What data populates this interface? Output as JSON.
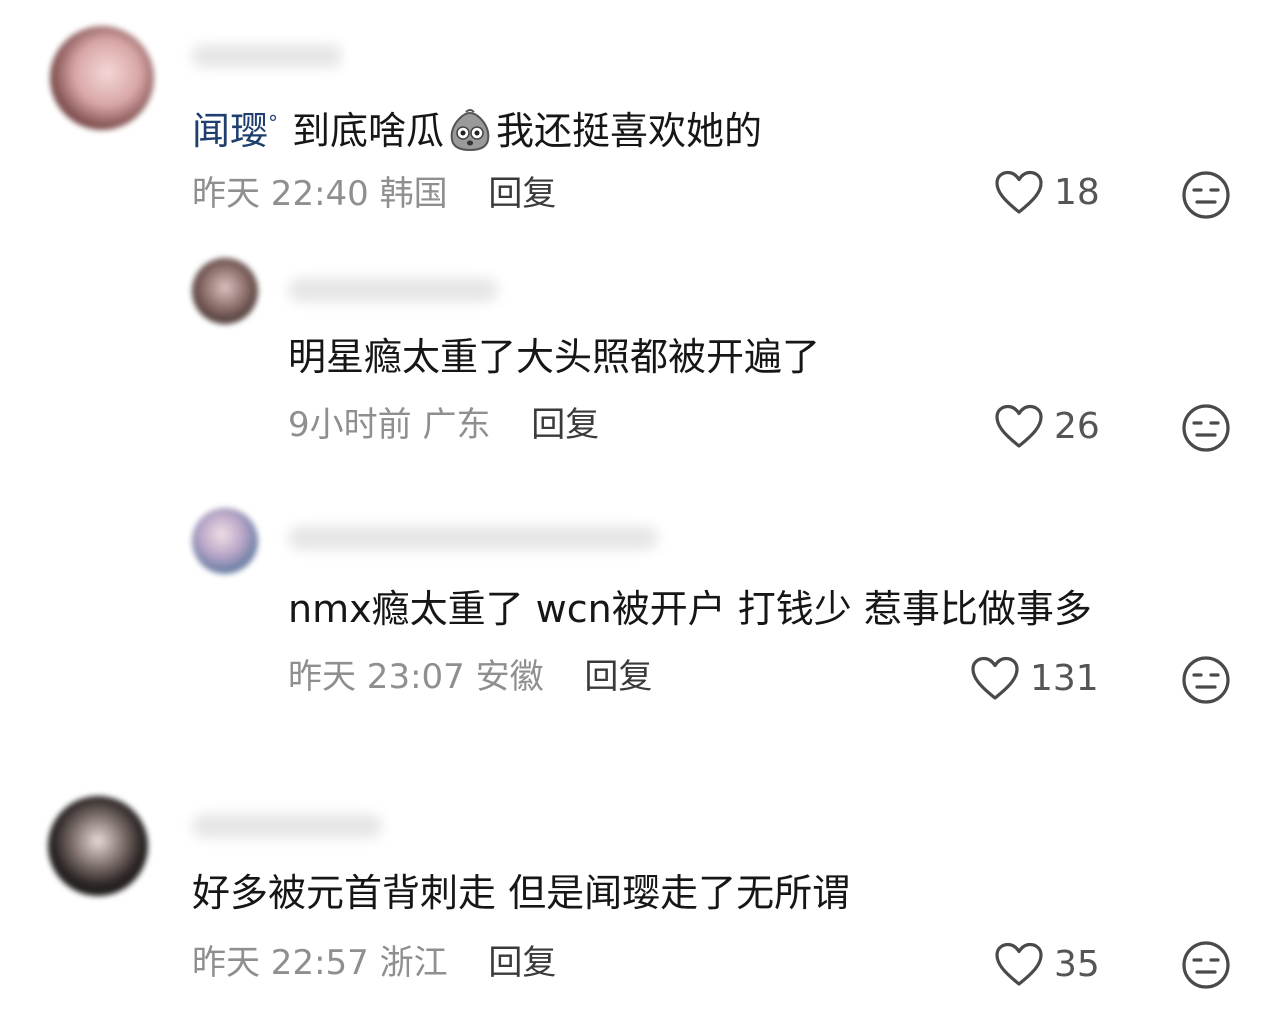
{
  "comments": [
    {
      "mention": "闻璎",
      "text": "到底啥瓜",
      "emoji_name": "shocked-emoji-icon",
      "text_after": "我还挺喜欢她的",
      "time": "昨天 22:40",
      "location": "韩国",
      "reply_label": "回复",
      "likes": "18"
    },
    {
      "text": "明星瘾太重了大头照都被开遍了",
      "time": "9小时前",
      "location": "广东",
      "reply_label": "回复",
      "likes": "26"
    },
    {
      "text": "nmx瘾太重了 wcn被开户 打钱少 惹事比做事多",
      "time": "昨天 23:07",
      "location": "安徽",
      "reply_label": "回复",
      "likes": "131"
    },
    {
      "text": "好多被元首背刺走 但是闻璎走了无所谓",
      "time": "昨天 22:57",
      "location": "浙江",
      "reply_label": "回复",
      "likes": "35"
    }
  ],
  "colors": {
    "mention": "#1f3f6e",
    "meta": "#8f8f8f",
    "text": "#161616"
  }
}
